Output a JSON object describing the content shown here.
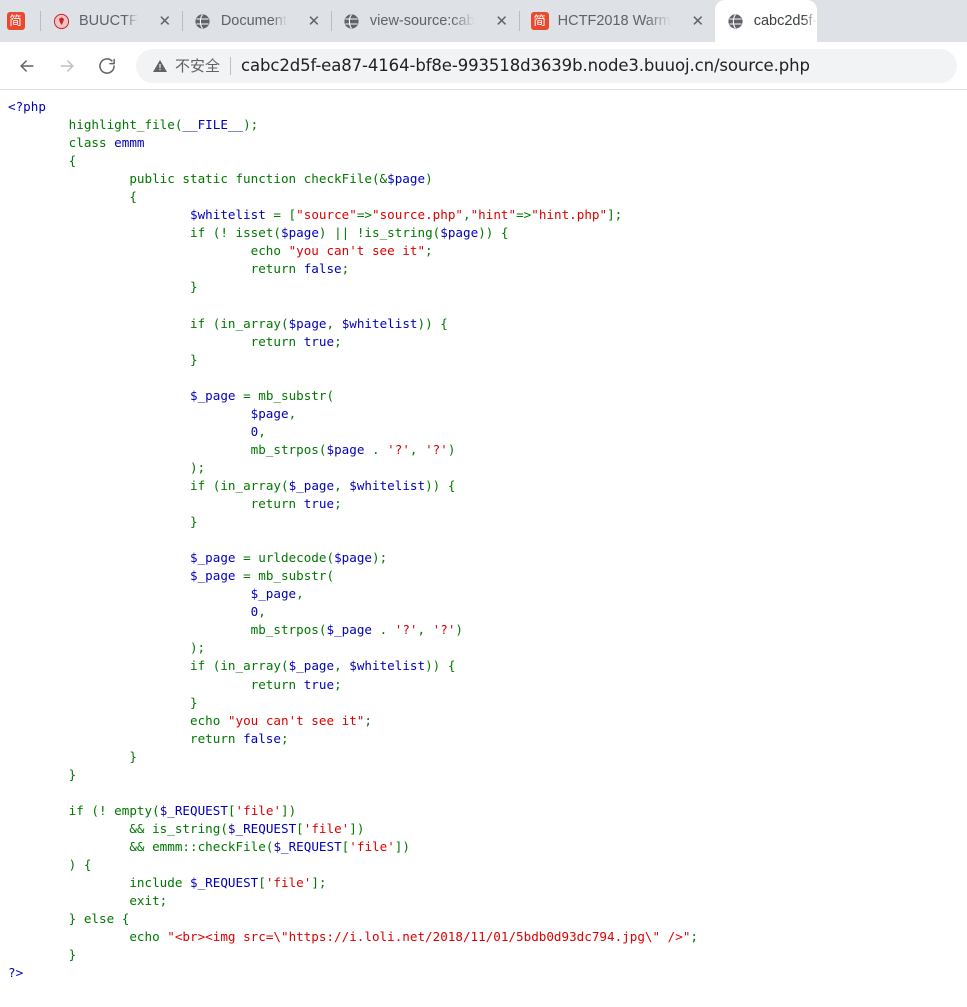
{
  "browser": {
    "tabs": [
      {
        "title": "",
        "favicon": "jian-icon",
        "pinned": true,
        "active": false,
        "close_label": "",
        "has_close": false
      },
      {
        "title": "BUUCTF",
        "favicon": "shield-icon",
        "pinned": false,
        "active": false,
        "close_label": "✕",
        "has_close": true
      },
      {
        "title": "Document",
        "favicon": "globe-icon",
        "pinned": false,
        "active": false,
        "close_label": "✕",
        "has_close": true
      },
      {
        "title": "view-source:cab",
        "favicon": "globe-icon",
        "pinned": false,
        "active": false,
        "close_label": "✕",
        "has_close": true
      },
      {
        "title": "HCTF2018 Warm",
        "favicon": "jian-icon",
        "pinned": false,
        "active": false,
        "close_label": "✕",
        "has_close": true
      },
      {
        "title": "cabc2d5f-",
        "favicon": "globe-icon",
        "pinned": false,
        "active": true,
        "close_label": "",
        "has_close": false
      }
    ],
    "toolbar": {
      "back_label": "←",
      "forward_label": "→",
      "reload_label": "⟳",
      "security_warning": "不安全",
      "url": "cabc2d5f-ea87-4164-bf8e-993518d3639b.node3.buuoj.cn/source.php"
    },
    "colors": {
      "tabstrip_bg": "#dee1e6",
      "active_tab_bg": "#ffffff",
      "omnibox_bg": "#f1f3f4",
      "favicon_red": "#e8492f",
      "php_string": "#dd0000",
      "php_keyword": "#007700",
      "php_variable": "#0000bb",
      "php_default": "#000000"
    }
  },
  "page": {
    "language": "php",
    "source_lines": [
      [
        {
          "t": "<?php",
          "c": "var"
        }
      ],
      [
        {
          "t": "        ",
          "c": "def"
        },
        {
          "t": "highlight_file",
          "c": "kw"
        },
        {
          "t": "(",
          "c": "kw"
        },
        {
          "t": "__FILE__",
          "c": "var"
        },
        {
          "t": ");",
          "c": "kw"
        }
      ],
      [
        {
          "t": "        ",
          "c": "def"
        },
        {
          "t": "class ",
          "c": "kw"
        },
        {
          "t": "emmm",
          "c": "var"
        }
      ],
      [
        {
          "t": "        {",
          "c": "kw"
        }
      ],
      [
        {
          "t": "                ",
          "c": "def"
        },
        {
          "t": "public static function ",
          "c": "kw"
        },
        {
          "t": "checkFile",
          "c": "kw"
        },
        {
          "t": "(&",
          "c": "kw"
        },
        {
          "t": "$page",
          "c": "var"
        },
        {
          "t": ")",
          "c": "kw"
        }
      ],
      [
        {
          "t": "                {",
          "c": "kw"
        }
      ],
      [
        {
          "t": "                        ",
          "c": "def"
        },
        {
          "t": "$whitelist",
          "c": "var"
        },
        {
          "t": " = [",
          "c": "kw"
        },
        {
          "t": "\"source\"",
          "c": "str"
        },
        {
          "t": "=>",
          "c": "kw"
        },
        {
          "t": "\"source.php\"",
          "c": "str"
        },
        {
          "t": ",",
          "c": "kw"
        },
        {
          "t": "\"hint\"",
          "c": "str"
        },
        {
          "t": "=>",
          "c": "kw"
        },
        {
          "t": "\"hint.php\"",
          "c": "str"
        },
        {
          "t": "];",
          "c": "kw"
        }
      ],
      [
        {
          "t": "                        ",
          "c": "def"
        },
        {
          "t": "if ",
          "c": "kw"
        },
        {
          "t": "(! ",
          "c": "kw"
        },
        {
          "t": "isset",
          "c": "kw"
        },
        {
          "t": "(",
          "c": "kw"
        },
        {
          "t": "$page",
          "c": "var"
        },
        {
          "t": ") || !",
          "c": "kw"
        },
        {
          "t": "is_string",
          "c": "kw"
        },
        {
          "t": "(",
          "c": "kw"
        },
        {
          "t": "$page",
          "c": "var"
        },
        {
          "t": ")) {",
          "c": "kw"
        }
      ],
      [
        {
          "t": "                                ",
          "c": "def"
        },
        {
          "t": "echo ",
          "c": "kw"
        },
        {
          "t": "\"you can't see it\"",
          "c": "str"
        },
        {
          "t": ";",
          "c": "kw"
        }
      ],
      [
        {
          "t": "                                ",
          "c": "def"
        },
        {
          "t": "return ",
          "c": "kw"
        },
        {
          "t": "false",
          "c": "var"
        },
        {
          "t": ";",
          "c": "kw"
        }
      ],
      [
        {
          "t": "                        }",
          "c": "kw"
        }
      ],
      [
        {
          "t": "",
          "c": "def"
        }
      ],
      [
        {
          "t": "                        ",
          "c": "def"
        },
        {
          "t": "if ",
          "c": "kw"
        },
        {
          "t": "(",
          "c": "kw"
        },
        {
          "t": "in_array",
          "c": "kw"
        },
        {
          "t": "(",
          "c": "kw"
        },
        {
          "t": "$page",
          "c": "var"
        },
        {
          "t": ", ",
          "c": "kw"
        },
        {
          "t": "$whitelist",
          "c": "var"
        },
        {
          "t": ")) {",
          "c": "kw"
        }
      ],
      [
        {
          "t": "                                ",
          "c": "def"
        },
        {
          "t": "return ",
          "c": "kw"
        },
        {
          "t": "true",
          "c": "var"
        },
        {
          "t": ";",
          "c": "kw"
        }
      ],
      [
        {
          "t": "                        }",
          "c": "kw"
        }
      ],
      [
        {
          "t": "",
          "c": "def"
        }
      ],
      [
        {
          "t": "                        ",
          "c": "def"
        },
        {
          "t": "$_page",
          "c": "var"
        },
        {
          "t": " = ",
          "c": "kw"
        },
        {
          "t": "mb_substr",
          "c": "kw"
        },
        {
          "t": "(",
          "c": "kw"
        }
      ],
      [
        {
          "t": "                                ",
          "c": "def"
        },
        {
          "t": "$page",
          "c": "var"
        },
        {
          "t": ",",
          "c": "kw"
        }
      ],
      [
        {
          "t": "                                ",
          "c": "def"
        },
        {
          "t": "0",
          "c": "var"
        },
        {
          "t": ",",
          "c": "kw"
        }
      ],
      [
        {
          "t": "                                ",
          "c": "def"
        },
        {
          "t": "mb_strpos",
          "c": "kw"
        },
        {
          "t": "(",
          "c": "kw"
        },
        {
          "t": "$page ",
          "c": "var"
        },
        {
          "t": ". ",
          "c": "kw"
        },
        {
          "t": "'?'",
          "c": "str"
        },
        {
          "t": ", ",
          "c": "kw"
        },
        {
          "t": "'?'",
          "c": "str"
        },
        {
          "t": ")",
          "c": "kw"
        }
      ],
      [
        {
          "t": "                        );",
          "c": "kw"
        }
      ],
      [
        {
          "t": "                        ",
          "c": "def"
        },
        {
          "t": "if ",
          "c": "kw"
        },
        {
          "t": "(",
          "c": "kw"
        },
        {
          "t": "in_array",
          "c": "kw"
        },
        {
          "t": "(",
          "c": "kw"
        },
        {
          "t": "$_page",
          "c": "var"
        },
        {
          "t": ", ",
          "c": "kw"
        },
        {
          "t": "$whitelist",
          "c": "var"
        },
        {
          "t": ")) {",
          "c": "kw"
        }
      ],
      [
        {
          "t": "                                ",
          "c": "def"
        },
        {
          "t": "return ",
          "c": "kw"
        },
        {
          "t": "true",
          "c": "var"
        },
        {
          "t": ";",
          "c": "kw"
        }
      ],
      [
        {
          "t": "                        }",
          "c": "kw"
        }
      ],
      [
        {
          "t": "",
          "c": "def"
        }
      ],
      [
        {
          "t": "                        ",
          "c": "def"
        },
        {
          "t": "$_page",
          "c": "var"
        },
        {
          "t": " = ",
          "c": "kw"
        },
        {
          "t": "urldecode",
          "c": "kw"
        },
        {
          "t": "(",
          "c": "kw"
        },
        {
          "t": "$page",
          "c": "var"
        },
        {
          "t": ");",
          "c": "kw"
        }
      ],
      [
        {
          "t": "                        ",
          "c": "def"
        },
        {
          "t": "$_page",
          "c": "var"
        },
        {
          "t": " = ",
          "c": "kw"
        },
        {
          "t": "mb_substr",
          "c": "kw"
        },
        {
          "t": "(",
          "c": "kw"
        }
      ],
      [
        {
          "t": "                                ",
          "c": "def"
        },
        {
          "t": "$_page",
          "c": "var"
        },
        {
          "t": ",",
          "c": "kw"
        }
      ],
      [
        {
          "t": "                                ",
          "c": "def"
        },
        {
          "t": "0",
          "c": "var"
        },
        {
          "t": ",",
          "c": "kw"
        }
      ],
      [
        {
          "t": "                                ",
          "c": "def"
        },
        {
          "t": "mb_strpos",
          "c": "kw"
        },
        {
          "t": "(",
          "c": "kw"
        },
        {
          "t": "$_page ",
          "c": "var"
        },
        {
          "t": ". ",
          "c": "kw"
        },
        {
          "t": "'?'",
          "c": "str"
        },
        {
          "t": ", ",
          "c": "kw"
        },
        {
          "t": "'?'",
          "c": "str"
        },
        {
          "t": ")",
          "c": "kw"
        }
      ],
      [
        {
          "t": "                        );",
          "c": "kw"
        }
      ],
      [
        {
          "t": "                        ",
          "c": "def"
        },
        {
          "t": "if ",
          "c": "kw"
        },
        {
          "t": "(",
          "c": "kw"
        },
        {
          "t": "in_array",
          "c": "kw"
        },
        {
          "t": "(",
          "c": "kw"
        },
        {
          "t": "$_page",
          "c": "var"
        },
        {
          "t": ", ",
          "c": "kw"
        },
        {
          "t": "$whitelist",
          "c": "var"
        },
        {
          "t": ")) {",
          "c": "kw"
        }
      ],
      [
        {
          "t": "                                ",
          "c": "def"
        },
        {
          "t": "return ",
          "c": "kw"
        },
        {
          "t": "true",
          "c": "var"
        },
        {
          "t": ";",
          "c": "kw"
        }
      ],
      [
        {
          "t": "                        }",
          "c": "kw"
        }
      ],
      [
        {
          "t": "                        ",
          "c": "def"
        },
        {
          "t": "echo ",
          "c": "kw"
        },
        {
          "t": "\"you can't see it\"",
          "c": "str"
        },
        {
          "t": ";",
          "c": "kw"
        }
      ],
      [
        {
          "t": "                        ",
          "c": "def"
        },
        {
          "t": "return ",
          "c": "kw"
        },
        {
          "t": "false",
          "c": "var"
        },
        {
          "t": ";",
          "c": "kw"
        }
      ],
      [
        {
          "t": "                }",
          "c": "kw"
        }
      ],
      [
        {
          "t": "        }",
          "c": "kw"
        }
      ],
      [
        {
          "t": "",
          "c": "def"
        }
      ],
      [
        {
          "t": "        ",
          "c": "def"
        },
        {
          "t": "if ",
          "c": "kw"
        },
        {
          "t": "(! ",
          "c": "kw"
        },
        {
          "t": "empty",
          "c": "kw"
        },
        {
          "t": "(",
          "c": "kw"
        },
        {
          "t": "$_REQUEST",
          "c": "var"
        },
        {
          "t": "[",
          "c": "kw"
        },
        {
          "t": "'file'",
          "c": "str"
        },
        {
          "t": "])",
          "c": "kw"
        }
      ],
      [
        {
          "t": "                ",
          "c": "def"
        },
        {
          "t": "&& ",
          "c": "kw"
        },
        {
          "t": "is_string",
          "c": "kw"
        },
        {
          "t": "(",
          "c": "kw"
        },
        {
          "t": "$_REQUEST",
          "c": "var"
        },
        {
          "t": "[",
          "c": "kw"
        },
        {
          "t": "'file'",
          "c": "str"
        },
        {
          "t": "])",
          "c": "kw"
        }
      ],
      [
        {
          "t": "                ",
          "c": "def"
        },
        {
          "t": "&& ",
          "c": "kw"
        },
        {
          "t": "emmm",
          "c": "kw"
        },
        {
          "t": "::",
          "c": "kw"
        },
        {
          "t": "checkFile",
          "c": "kw"
        },
        {
          "t": "(",
          "c": "kw"
        },
        {
          "t": "$_REQUEST",
          "c": "var"
        },
        {
          "t": "[",
          "c": "kw"
        },
        {
          "t": "'file'",
          "c": "str"
        },
        {
          "t": "])",
          "c": "kw"
        }
      ],
      [
        {
          "t": "        ) {",
          "c": "kw"
        }
      ],
      [
        {
          "t": "                ",
          "c": "def"
        },
        {
          "t": "include ",
          "c": "kw"
        },
        {
          "t": "$_REQUEST",
          "c": "var"
        },
        {
          "t": "[",
          "c": "kw"
        },
        {
          "t": "'file'",
          "c": "str"
        },
        {
          "t": "];",
          "c": "kw"
        }
      ],
      [
        {
          "t": "                ",
          "c": "def"
        },
        {
          "t": "exit",
          "c": "kw"
        },
        {
          "t": ";",
          "c": "kw"
        }
      ],
      [
        {
          "t": "        } ",
          "c": "kw"
        },
        {
          "t": "else ",
          "c": "kw"
        },
        {
          "t": "{",
          "c": "kw"
        }
      ],
      [
        {
          "t": "                ",
          "c": "def"
        },
        {
          "t": "echo ",
          "c": "kw"
        },
        {
          "t": "\"<br><img src=\\\"https://i.loli.net/2018/11/01/5bdb0d93dc794.jpg\\\" />\"",
          "c": "str"
        },
        {
          "t": ";",
          "c": "kw"
        }
      ],
      [
        {
          "t": "        }",
          "c": "kw"
        }
      ],
      [
        {
          "t": "?>",
          "c": "var"
        }
      ]
    ]
  }
}
